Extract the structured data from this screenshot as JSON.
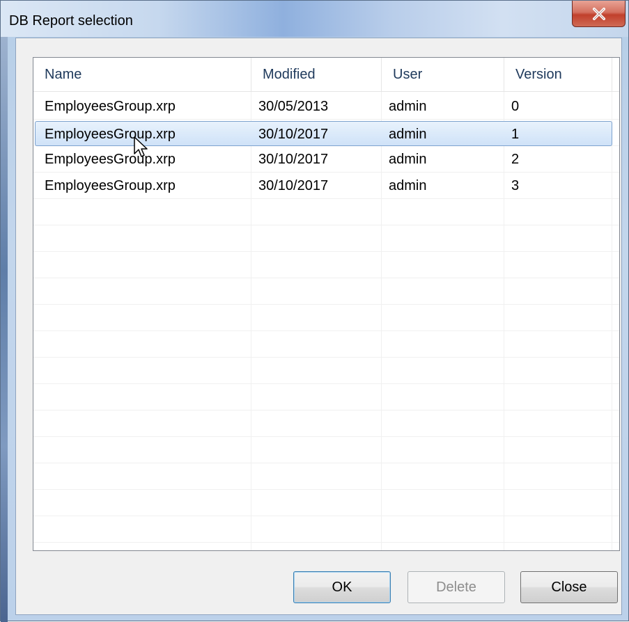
{
  "window": {
    "title": "DB Report selection"
  },
  "list": {
    "columns": [
      "Name",
      "Modified",
      "User",
      "Version"
    ],
    "rows": [
      {
        "name": "EmployeesGroup.xrp",
        "modified": "30/05/2013",
        "user": "admin",
        "version": "0"
      },
      {
        "name": "EmployeesGroup.xrp",
        "modified": "30/10/2017",
        "user": "admin",
        "version": "1"
      },
      {
        "name": "EmployeesGroup.xrp",
        "modified": "30/10/2017",
        "user": "admin",
        "version": "2"
      },
      {
        "name": "EmployeesGroup.xrp",
        "modified": "30/10/2017",
        "user": "admin",
        "version": "3"
      }
    ],
    "selected_row": 1
  },
  "buttons": {
    "ok": "OK",
    "delete": "Delete",
    "close": "Close"
  },
  "icons": {
    "close": "close-icon",
    "cursor": "mouse-pointer-icon"
  },
  "colors": {
    "selection_fill": "#cfe2f8",
    "selection_border": "#7da2ce",
    "close_button": "#c1402c"
  }
}
